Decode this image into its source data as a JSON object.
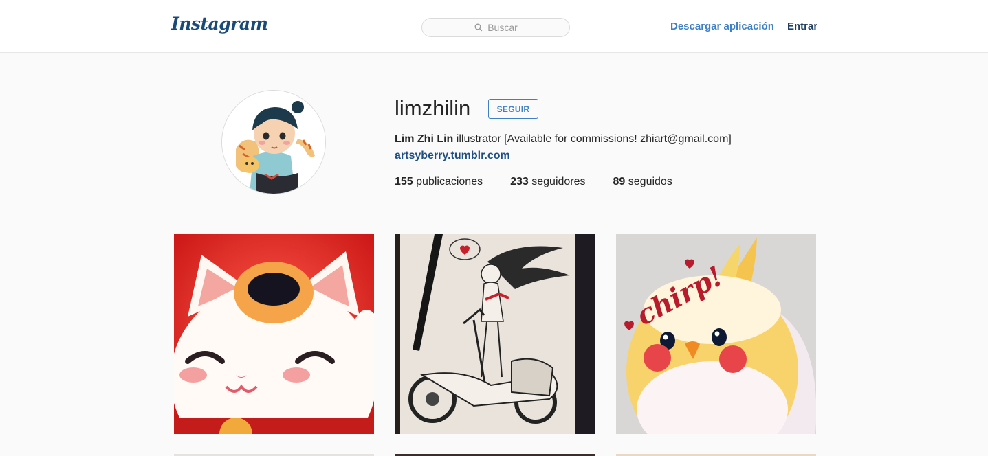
{
  "header": {
    "logo_text": "Instagram",
    "search_placeholder": "Buscar",
    "download_link": "Descargar aplicación",
    "login_link": "Entrar"
  },
  "profile": {
    "username": "limzhilin",
    "follow_button": "SEGUIR",
    "full_name": "Lim Zhi Lin",
    "bio_text": " illustrator [Available for commissions! zhiart@gmail.com]",
    "website": "artsyberry.tumblr.com",
    "stats": {
      "posts_count": "155",
      "posts_label": " publicaciones",
      "followers_count": "233",
      "followers_label": " seguidores",
      "following_count": "89",
      "following_label": " seguidos"
    }
  },
  "posts": [
    {
      "subject": "lucky cat illustration"
    },
    {
      "subject": "girl on scooter ink sketch"
    },
    {
      "subject": "cockatiel chirp illustration",
      "text": "chirp!"
    }
  ],
  "colors": {
    "accent": "#3f80c4",
    "logo": "#1a4a78",
    "background": "#fafafa"
  }
}
